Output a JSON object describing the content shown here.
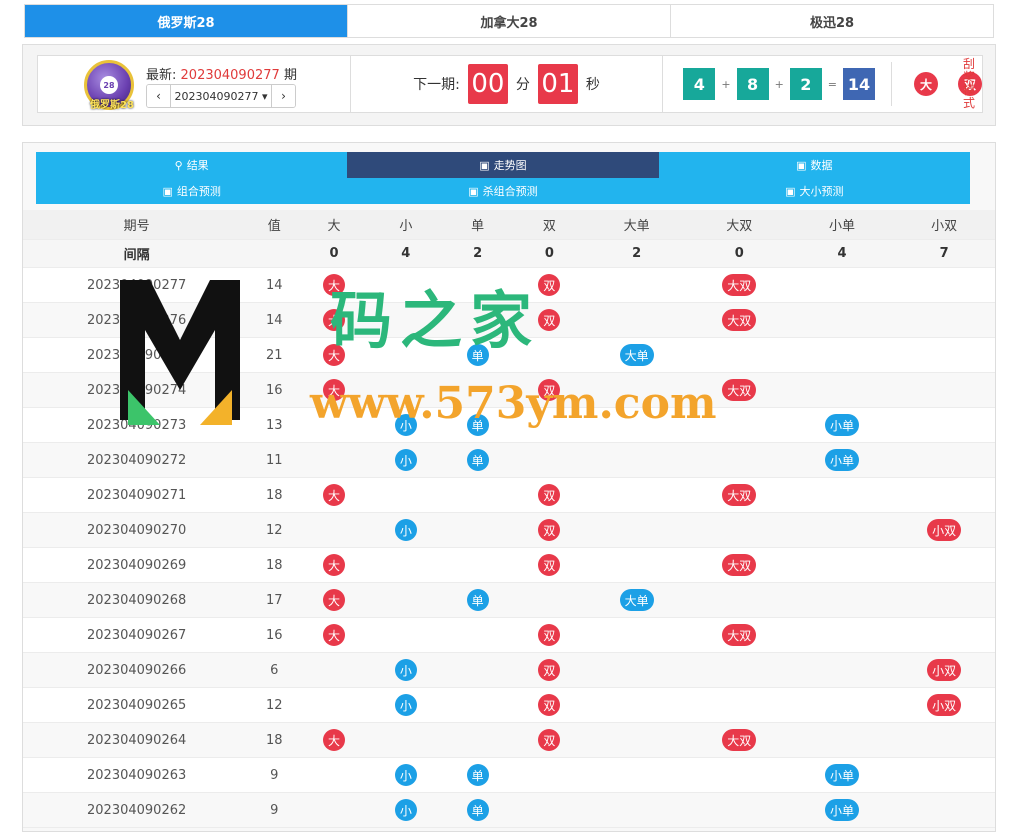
{
  "top_tabs": [
    "俄罗斯28",
    "加拿大28",
    "极迅28"
  ],
  "logo_text": "俄罗斯28",
  "latest": {
    "label": "最新:",
    "issue": "202304090277",
    "suffix": "期",
    "select_value": "202304090277",
    "prev": "‹",
    "next": "›"
  },
  "countdown": {
    "label": "下一期:",
    "min": "00",
    "min_unit": "分",
    "sec": "01",
    "sec_unit": "秒"
  },
  "result": {
    "n1": "4",
    "n2": "8",
    "n3": "2",
    "sum": "14",
    "plus": "+",
    "eq": "=",
    "size": "大",
    "parity": "双",
    "mode": "刮奖模式"
  },
  "nav": [
    [
      {
        "icon": "search-icon",
        "label": "结果"
      },
      {
        "icon": "chart-icon",
        "label": "走势图"
      },
      {
        "icon": "chart-icon",
        "label": "数据"
      }
    ],
    [
      {
        "icon": "chart-icon",
        "label": "组合预测"
      },
      {
        "icon": "chart-icon",
        "label": "杀组合预测"
      },
      {
        "icon": "chart-icon",
        "label": "大小预测"
      }
    ]
  ],
  "table": {
    "headers": [
      "期号",
      "值",
      "大",
      "小",
      "单",
      "双",
      "大单",
      "大双",
      "小单",
      "小双"
    ],
    "interval": [
      "间隔",
      "",
      "0",
      "4",
      "2",
      "0",
      "2",
      "0",
      "4",
      "7"
    ],
    "rows": [
      {
        "issue": "202304090277",
        "value": "14"
      },
      {
        "issue": "202304090276",
        "value": "14"
      },
      {
        "issue": "202304090275",
        "value": "21"
      },
      {
        "issue": "202304090274",
        "value": "16"
      },
      {
        "issue": "202304090273",
        "value": "13"
      },
      {
        "issue": "202304090272",
        "value": "11"
      },
      {
        "issue": "202304090271",
        "value": "18"
      },
      {
        "issue": "202304090270",
        "value": "12"
      },
      {
        "issue": "202304090269",
        "value": "18"
      },
      {
        "issue": "202304090268",
        "value": "17"
      },
      {
        "issue": "202304090267",
        "value": "16"
      },
      {
        "issue": "202304090266",
        "value": "6"
      },
      {
        "issue": "202304090265",
        "value": "12"
      },
      {
        "issue": "202304090264",
        "value": "18"
      },
      {
        "issue": "202304090263",
        "value": "9"
      },
      {
        "issue": "202304090262",
        "value": "9"
      }
    ]
  },
  "colors": {
    "red": "#e8394a",
    "blue": "#1ca0e6",
    "nav": "#22b4ee",
    "nav_active": "#2f4a7a",
    "tab_active": "#1e90e8"
  },
  "watermark": {
    "cn": "码之家",
    "url": "www.573ym.com"
  }
}
